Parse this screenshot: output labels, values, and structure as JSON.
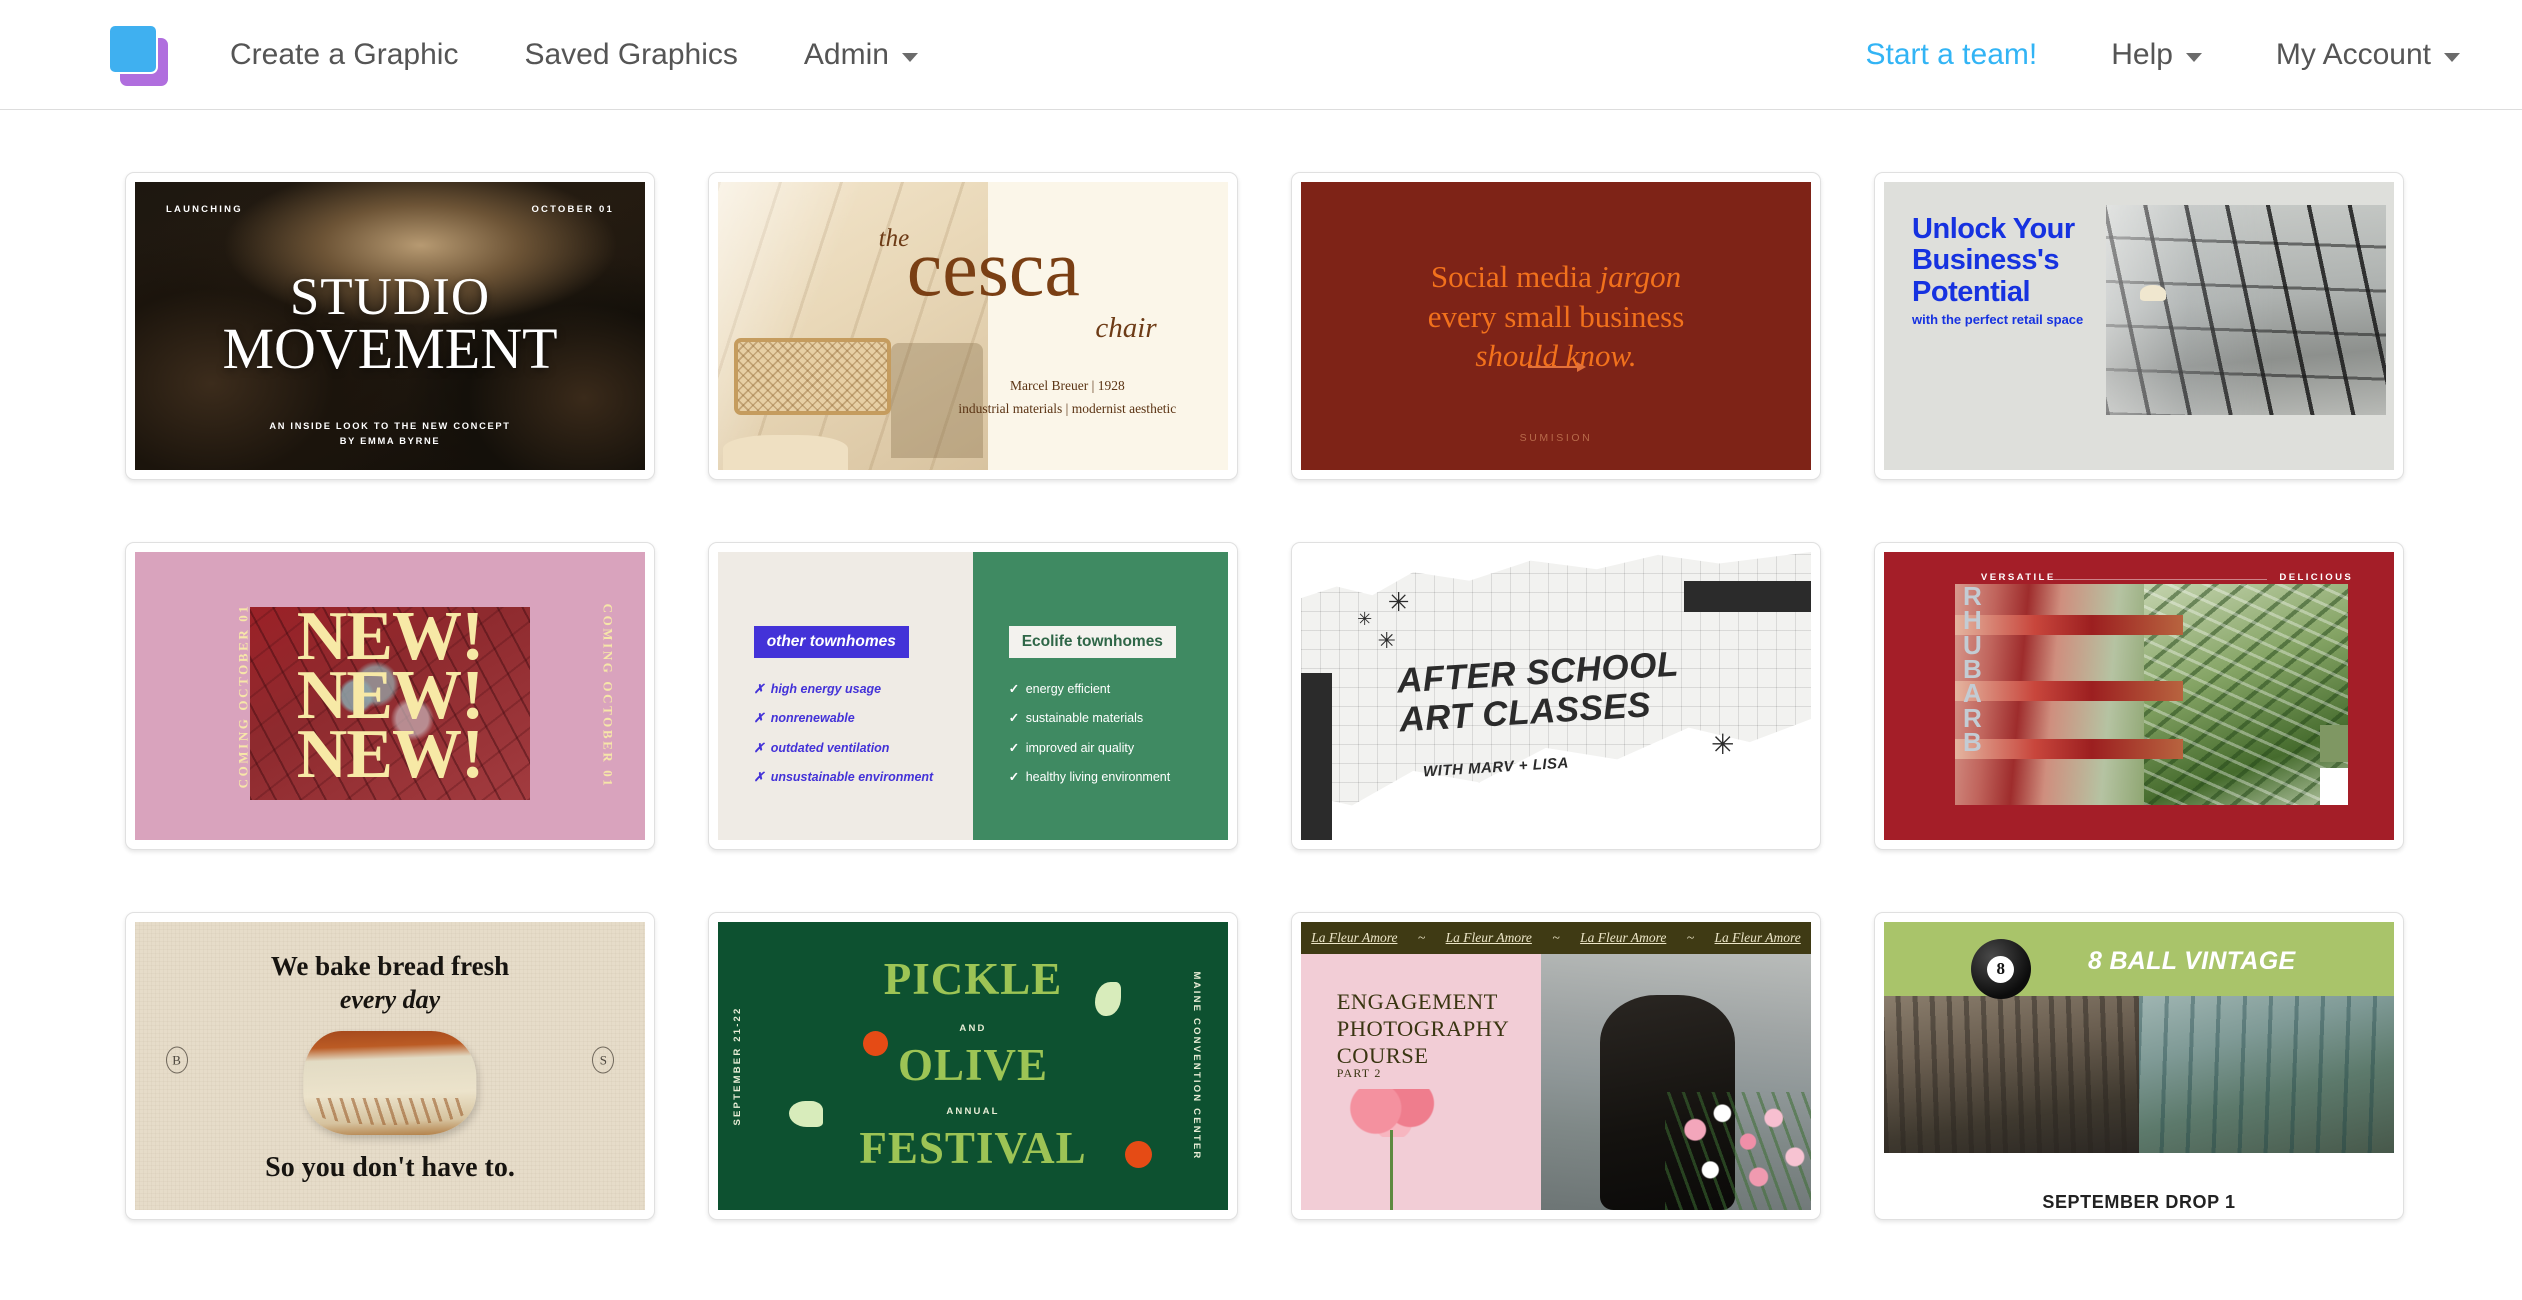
{
  "header": {
    "logo_name": "brand-logo",
    "logo_colors": {
      "blue": "#3fb0f0",
      "purple": "#b06ede"
    },
    "nav_left": [
      {
        "label": "Create a Graphic",
        "has_caret": false
      },
      {
        "label": "Saved Graphics",
        "has_caret": false
      },
      {
        "label": "Admin",
        "has_caret": true
      }
    ],
    "nav_right": [
      {
        "label": "Start a team!",
        "has_caret": false,
        "accent": true,
        "color": "#32b4f5"
      },
      {
        "label": "Help",
        "has_caret": true
      },
      {
        "label": "My Account",
        "has_caret": true
      }
    ]
  },
  "gallery": {
    "cards": [
      {
        "id": "studio-movement",
        "top_left": "LAUNCHING",
        "top_right": "OCTOBER 01",
        "title_line1": "STUDIO",
        "title_line2": "MOVEMENT",
        "footer_line1": "AN INSIDE LOOK TO THE NEW CONCEPT",
        "footer_line2": "BY EMMA BYRNE"
      },
      {
        "id": "cesca-chair",
        "word_the": "the",
        "word_main": "cesca",
        "word_sub": "chair",
        "meta_line1": "Marcel Breuer | 1928",
        "meta_line2": "industrial materials | modernist aesthetic"
      },
      {
        "id": "social-media-jargon",
        "line1_a": "Social media ",
        "line1_b": "jargon",
        "line2": "every small business",
        "line3": "should know.",
        "brand": "SUMISION"
      },
      {
        "id": "unlock-business-potential",
        "head_line1": "Unlock Your",
        "head_line2": "Business's",
        "head_line3": "Potential",
        "sub": "with the perfect retail space"
      },
      {
        "id": "new-new-new",
        "side_left": "COMING OCTOBER 01",
        "side_right": "COMING OCTOBER 01",
        "line1": "NEW!",
        "line2": "NEW!",
        "line3": "NEW!"
      },
      {
        "id": "ecolife-townhomes",
        "left_pill": "other townhomes",
        "right_pill": "Ecolife townhomes",
        "left_mark": "✗",
        "right_mark": "✓",
        "left_items": [
          "high energy usage",
          "nonrenewable",
          "outdated ventilation",
          "unsustainable environment"
        ],
        "right_items": [
          "energy efficient",
          "sustainable materials",
          "improved air quality",
          "healthy living environment"
        ]
      },
      {
        "id": "after-school-art-classes",
        "title_line1": "AFTER SCHOOL",
        "title_line2": "ART CLASSES",
        "subtitle": "WITH MARV + LISA",
        "star_glyph": "✳"
      },
      {
        "id": "rhubarb",
        "top_left": "VERSATILE",
        "top_right": "DELICIOUS",
        "vertical_title": "RHUBARB"
      },
      {
        "id": "we-bake-bread",
        "line1": "We bake bread fresh",
        "line2": "every day",
        "line3": "So you don't have to.",
        "monogram_left": "B",
        "monogram_right": "S"
      },
      {
        "id": "pickle-olive-festival",
        "side_left": "SEPTEMBER 21-22",
        "side_right": "MAINE CONVENTION CENTER",
        "big1": "PICKLE",
        "small1": "AND",
        "big2": "OLIVE",
        "small2": "ANNUAL",
        "big3": "FESTIVAL"
      },
      {
        "id": "engagement-photography-course",
        "ticker": "La Fleur Amore",
        "ticker_sep": "~",
        "ticker_repeat": 4,
        "title_line1": "ENGAGEMENT",
        "title_line2": "PHOTOGRAPHY",
        "title_line3": "COURSE",
        "part": "PART 2"
      },
      {
        "id": "8-ball-vintage",
        "ball_number": "8",
        "logotext": "8 BALL VINTAGE",
        "caption": "SEPTEMBER DROP 1"
      }
    ]
  }
}
